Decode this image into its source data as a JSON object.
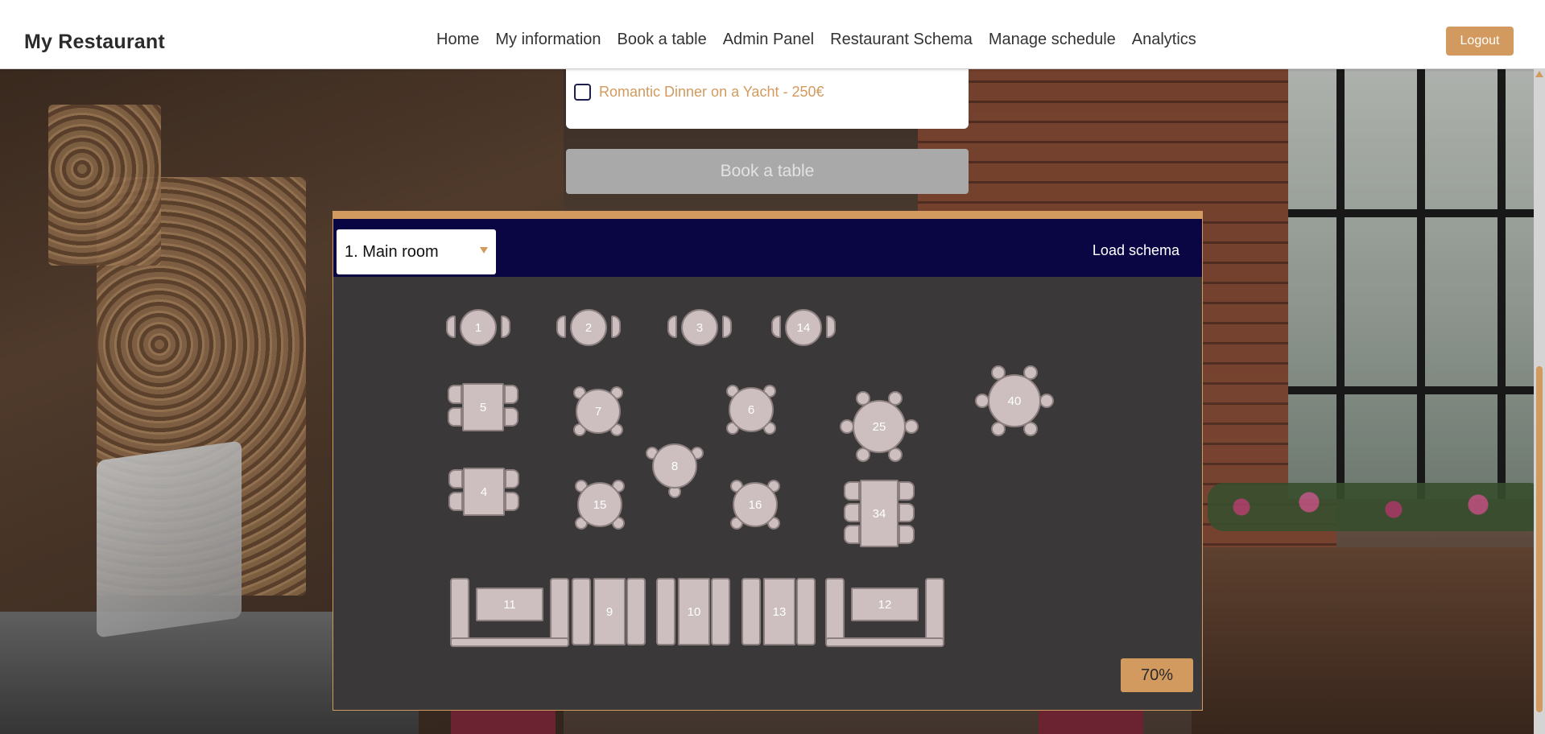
{
  "brand": "My Restaurant",
  "nav": [
    "Home",
    "My information",
    "Book a table",
    "Admin Panel",
    "Restaurant Schema",
    "Manage schedule",
    "Analytics"
  ],
  "logout_label": "Logout",
  "booking": {
    "option_label": "Romantic Dinner on a Yacht - 250€",
    "option_checked": false,
    "book_button": "Book a table"
  },
  "schema": {
    "room_selected": "1. Main room",
    "load_label": "Load schema",
    "zoom": "70%",
    "tables": [
      {
        "id": "1",
        "shape": "round-2"
      },
      {
        "id": "2",
        "shape": "round-2"
      },
      {
        "id": "3",
        "shape": "round-2"
      },
      {
        "id": "14",
        "shape": "round-2"
      },
      {
        "id": "5",
        "shape": "rect-4"
      },
      {
        "id": "7",
        "shape": "round-4"
      },
      {
        "id": "6",
        "shape": "round-4"
      },
      {
        "id": "25",
        "shape": "round-6"
      },
      {
        "id": "40",
        "shape": "round-6"
      },
      {
        "id": "8",
        "shape": "round-3"
      },
      {
        "id": "4",
        "shape": "rect-4"
      },
      {
        "id": "15",
        "shape": "round-4"
      },
      {
        "id": "16",
        "shape": "round-4"
      },
      {
        "id": "34",
        "shape": "rect-6"
      },
      {
        "id": "11",
        "shape": "sofa-u"
      },
      {
        "id": "9",
        "shape": "booth"
      },
      {
        "id": "10",
        "shape": "booth"
      },
      {
        "id": "13",
        "shape": "booth"
      },
      {
        "id": "12",
        "shape": "sofa-u"
      }
    ]
  },
  "colors": {
    "accent": "#d29a5e",
    "schema_header": "#0a0644",
    "schema_bg": "#3a3838",
    "table_fill": "#cdbfbf",
    "disabled_button": "#a9a9a9"
  }
}
